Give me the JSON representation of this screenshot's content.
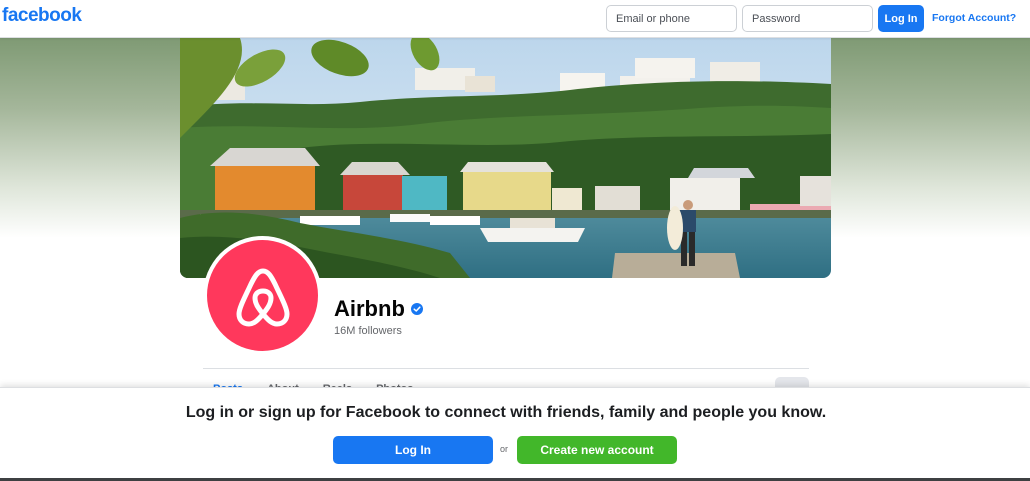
{
  "header": {
    "logo": "facebook",
    "email_placeholder": "Email or phone",
    "password_placeholder": "Password",
    "login_label": "Log In",
    "forgot_label": "Forgot Account?"
  },
  "profile": {
    "name": "Airbnb",
    "followers": "16M followers",
    "verified_icon": "verified-badge-icon",
    "logo_icon": "airbnb-logo-icon"
  },
  "tabs": [
    "Posts",
    "About",
    "Reels",
    "Photos"
  ],
  "prompt": {
    "text": "Log in or sign up for Facebook to connect with friends, family and people you know.",
    "login_label": "Log In",
    "or_label": "or",
    "create_label": "Create new account"
  },
  "colors": {
    "brand_blue": "#1877f2",
    "create_green": "#42b72a",
    "airbnb_red": "#ff385c"
  }
}
